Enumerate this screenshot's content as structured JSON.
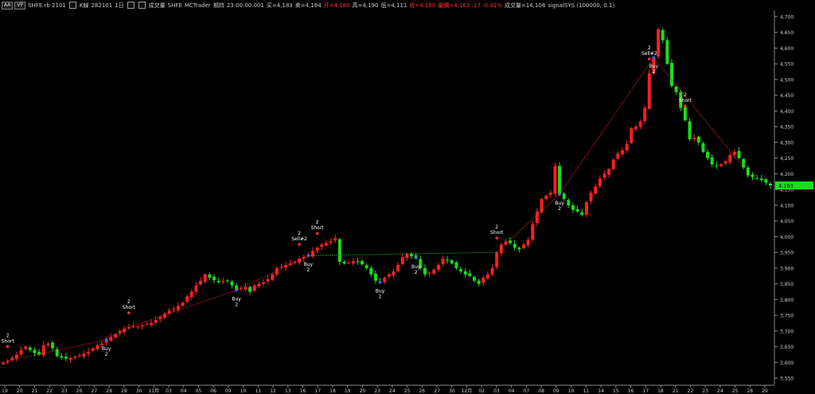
{
  "toolbar": {
    "symbol_btn": "AA",
    "vp_btn": "VP",
    "instrument": "SHFE.rb 2101",
    "field_kline": "K線",
    "contract": "282101",
    "period": "1日",
    "field_volume": "成交量",
    "exchange": "SHFE",
    "source": "MCTrader",
    "field_holding": "期持",
    "time": "23:00:00.001",
    "buy": "买=4,183",
    "sell": "卖=4,184",
    "open": "开=4,180",
    "high": "高=4,190",
    "low": "低=4,111",
    "close": "收=4,160",
    "change": "量價=4,163 -17 -0.41%",
    "volume": "成交量=14,108",
    "signal": "signalSYS (100000, 0.1)"
  },
  "colors": {
    "up": "#ff2020",
    "down": "#18e018",
    "price_tag": "#18e018",
    "connector": "#ff3030",
    "connector_green": "#30d030"
  },
  "chart_data": {
    "type": "candlestick",
    "y_ticks": [
      "4,700",
      "4,650",
      "4,600",
      "4,550",
      "4,500",
      "4,450",
      "4,400",
      "4,350",
      "4,300",
      "4,250",
      "4,200",
      "4,150",
      "4,100",
      "4,050",
      "4,000",
      "3,950",
      "3,900",
      "3,850",
      "3,800",
      "3,750",
      "3,700",
      "3,650",
      "3,600",
      "3,550"
    ],
    "x_ticks": [
      "19",
      "20",
      "21",
      "22",
      "23",
      "26",
      "27",
      "28",
      "29",
      "30",
      "11月",
      "03",
      "04",
      "05",
      "06",
      "09",
      "10",
      "11",
      "12",
      "13",
      "16",
      "17",
      "18",
      "19",
      "20",
      "23",
      "24",
      "25",
      "26",
      "27",
      "30",
      "12月",
      "02",
      "03",
      "04",
      "07",
      "08",
      "09",
      "10",
      "11",
      "14",
      "15",
      "16",
      "17",
      "18",
      "21",
      "22",
      "23",
      "24",
      "25",
      "28",
      "29"
    ],
    "last_price": "4,163",
    "ylim": [
      3530,
      4720
    ],
    "closes": [
      3600,
      3605,
      3615,
      3625,
      3640,
      3650,
      3640,
      3630,
      3625,
      3655,
      3660,
      3645,
      3620,
      3615,
      3612,
      3614,
      3618,
      3622,
      3628,
      3634,
      3645,
      3655,
      3660,
      3672,
      3680,
      3690,
      3700,
      3708,
      3712,
      3715,
      3715,
      3718,
      3722,
      3726,
      3735,
      3745,
      3755,
      3765,
      3770,
      3780,
      3790,
      3810,
      3825,
      3845,
      3860,
      3880,
      3870,
      3862,
      3855,
      3858,
      3860,
      3845,
      3830,
      3835,
      3840,
      3825,
      3845,
      3850,
      3855,
      3865,
      3880,
      3900,
      3905,
      3910,
      3915,
      3920,
      3930,
      3935,
      3940,
      3955,
      3965,
      3975,
      3980,
      3985,
      3995,
      3920,
      3915,
      3918,
      3922,
      3920,
      3912,
      3900,
      3880,
      3860,
      3855,
      3870,
      3880,
      3890,
      3910,
      3935,
      3945,
      3938,
      3932,
      3900,
      3880,
      3885,
      3895,
      3910,
      3930,
      3925,
      3915,
      3900,
      3890,
      3880,
      3875,
      3860,
      3850,
      3870,
      3880,
      3900,
      3950,
      3975,
      3985,
      3980,
      3965,
      3960,
      3975,
      3990,
      4040,
      4080,
      4120,
      4130,
      4140,
      4225,
      4135,
      4120,
      4100,
      4085,
      4080,
      4070,
      4110,
      4140,
      4160,
      4185,
      4200,
      4215,
      4245,
      4265,
      4275,
      4295,
      4345,
      4350,
      4365,
      4410,
      4520,
      4570,
      4660,
      4625,
      4550,
      4480,
      4460,
      4410,
      4370,
      4310,
      4315,
      4300,
      4270,
      4250,
      4230,
      4225,
      4230,
      4240,
      4260,
      4270,
      4250,
      4220,
      4195,
      4190,
      4185,
      4180,
      4172,
      4163
    ]
  },
  "signals": [
    {
      "kind": "short",
      "line1": "2",
      "line2": "Short"
    },
    {
      "kind": "buy",
      "line1": "Buy",
      "line2": "2"
    },
    {
      "kind": "short",
      "line1": "2",
      "line2": "Short"
    },
    {
      "kind": "buy",
      "line1": "Buy",
      "line2": "2"
    },
    {
      "kind": "short",
      "line1": "2",
      "line2": "Sell#2"
    },
    {
      "kind": "buy",
      "line1": "Buy",
      "line2": "2"
    },
    {
      "kind": "short",
      "line1": "2",
      "line2": "Short"
    },
    {
      "kind": "buy",
      "line1": "Buy",
      "line2": "2"
    },
    {
      "kind": "buy",
      "line1": "Buy",
      "line2": "2"
    },
    {
      "kind": "short",
      "line1": "2",
      "line2": "Short"
    },
    {
      "kind": "buy",
      "line1": "Buy",
      "line2": "2"
    },
    {
      "kind": "short",
      "line1": "2",
      "line2": "Sell#2"
    },
    {
      "kind": "buy",
      "line1": "Buy",
      "line2": "2"
    },
    {
      "kind": "short",
      "line1": "2",
      "line2": "Short"
    }
  ]
}
